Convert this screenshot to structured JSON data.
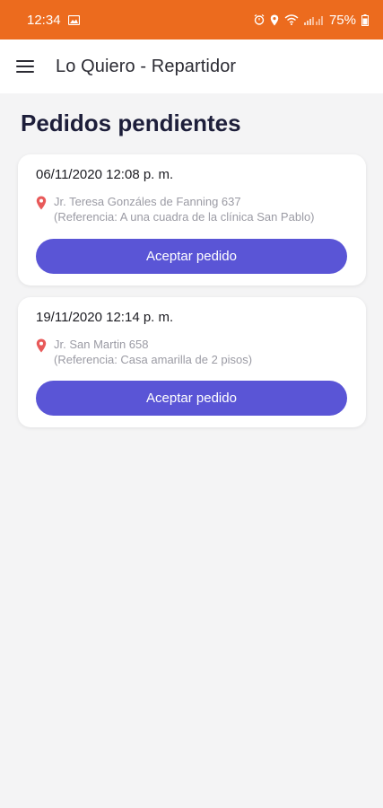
{
  "status_bar": {
    "time": "12:34",
    "battery": "75%",
    "background_color": "#ec6b1e"
  },
  "app_bar": {
    "menu_icon": "hamburger-menu-icon",
    "title": "Lo Quiero - Repartidor"
  },
  "page": {
    "title": "Pedidos pendientes"
  },
  "orders": [
    {
      "date": "06/11/2020 12:08 p. m.",
      "address": "Jr. Teresa Gonzáles de Fanning 637",
      "reference": "(Referencia: A una cuadra de la clínica San Pablo)",
      "button_label": "Aceptar pedido"
    },
    {
      "date": "19/11/2020 12:14 p. m.",
      "address": "Jr. San Martin 658",
      "reference": "(Referencia: Casa amarilla de 2 pisos)",
      "button_label": "Aceptar pedido"
    }
  ],
  "colors": {
    "accent": "#5a55d6",
    "pin": "#e85a5a",
    "status_bar": "#ec6b1e"
  }
}
